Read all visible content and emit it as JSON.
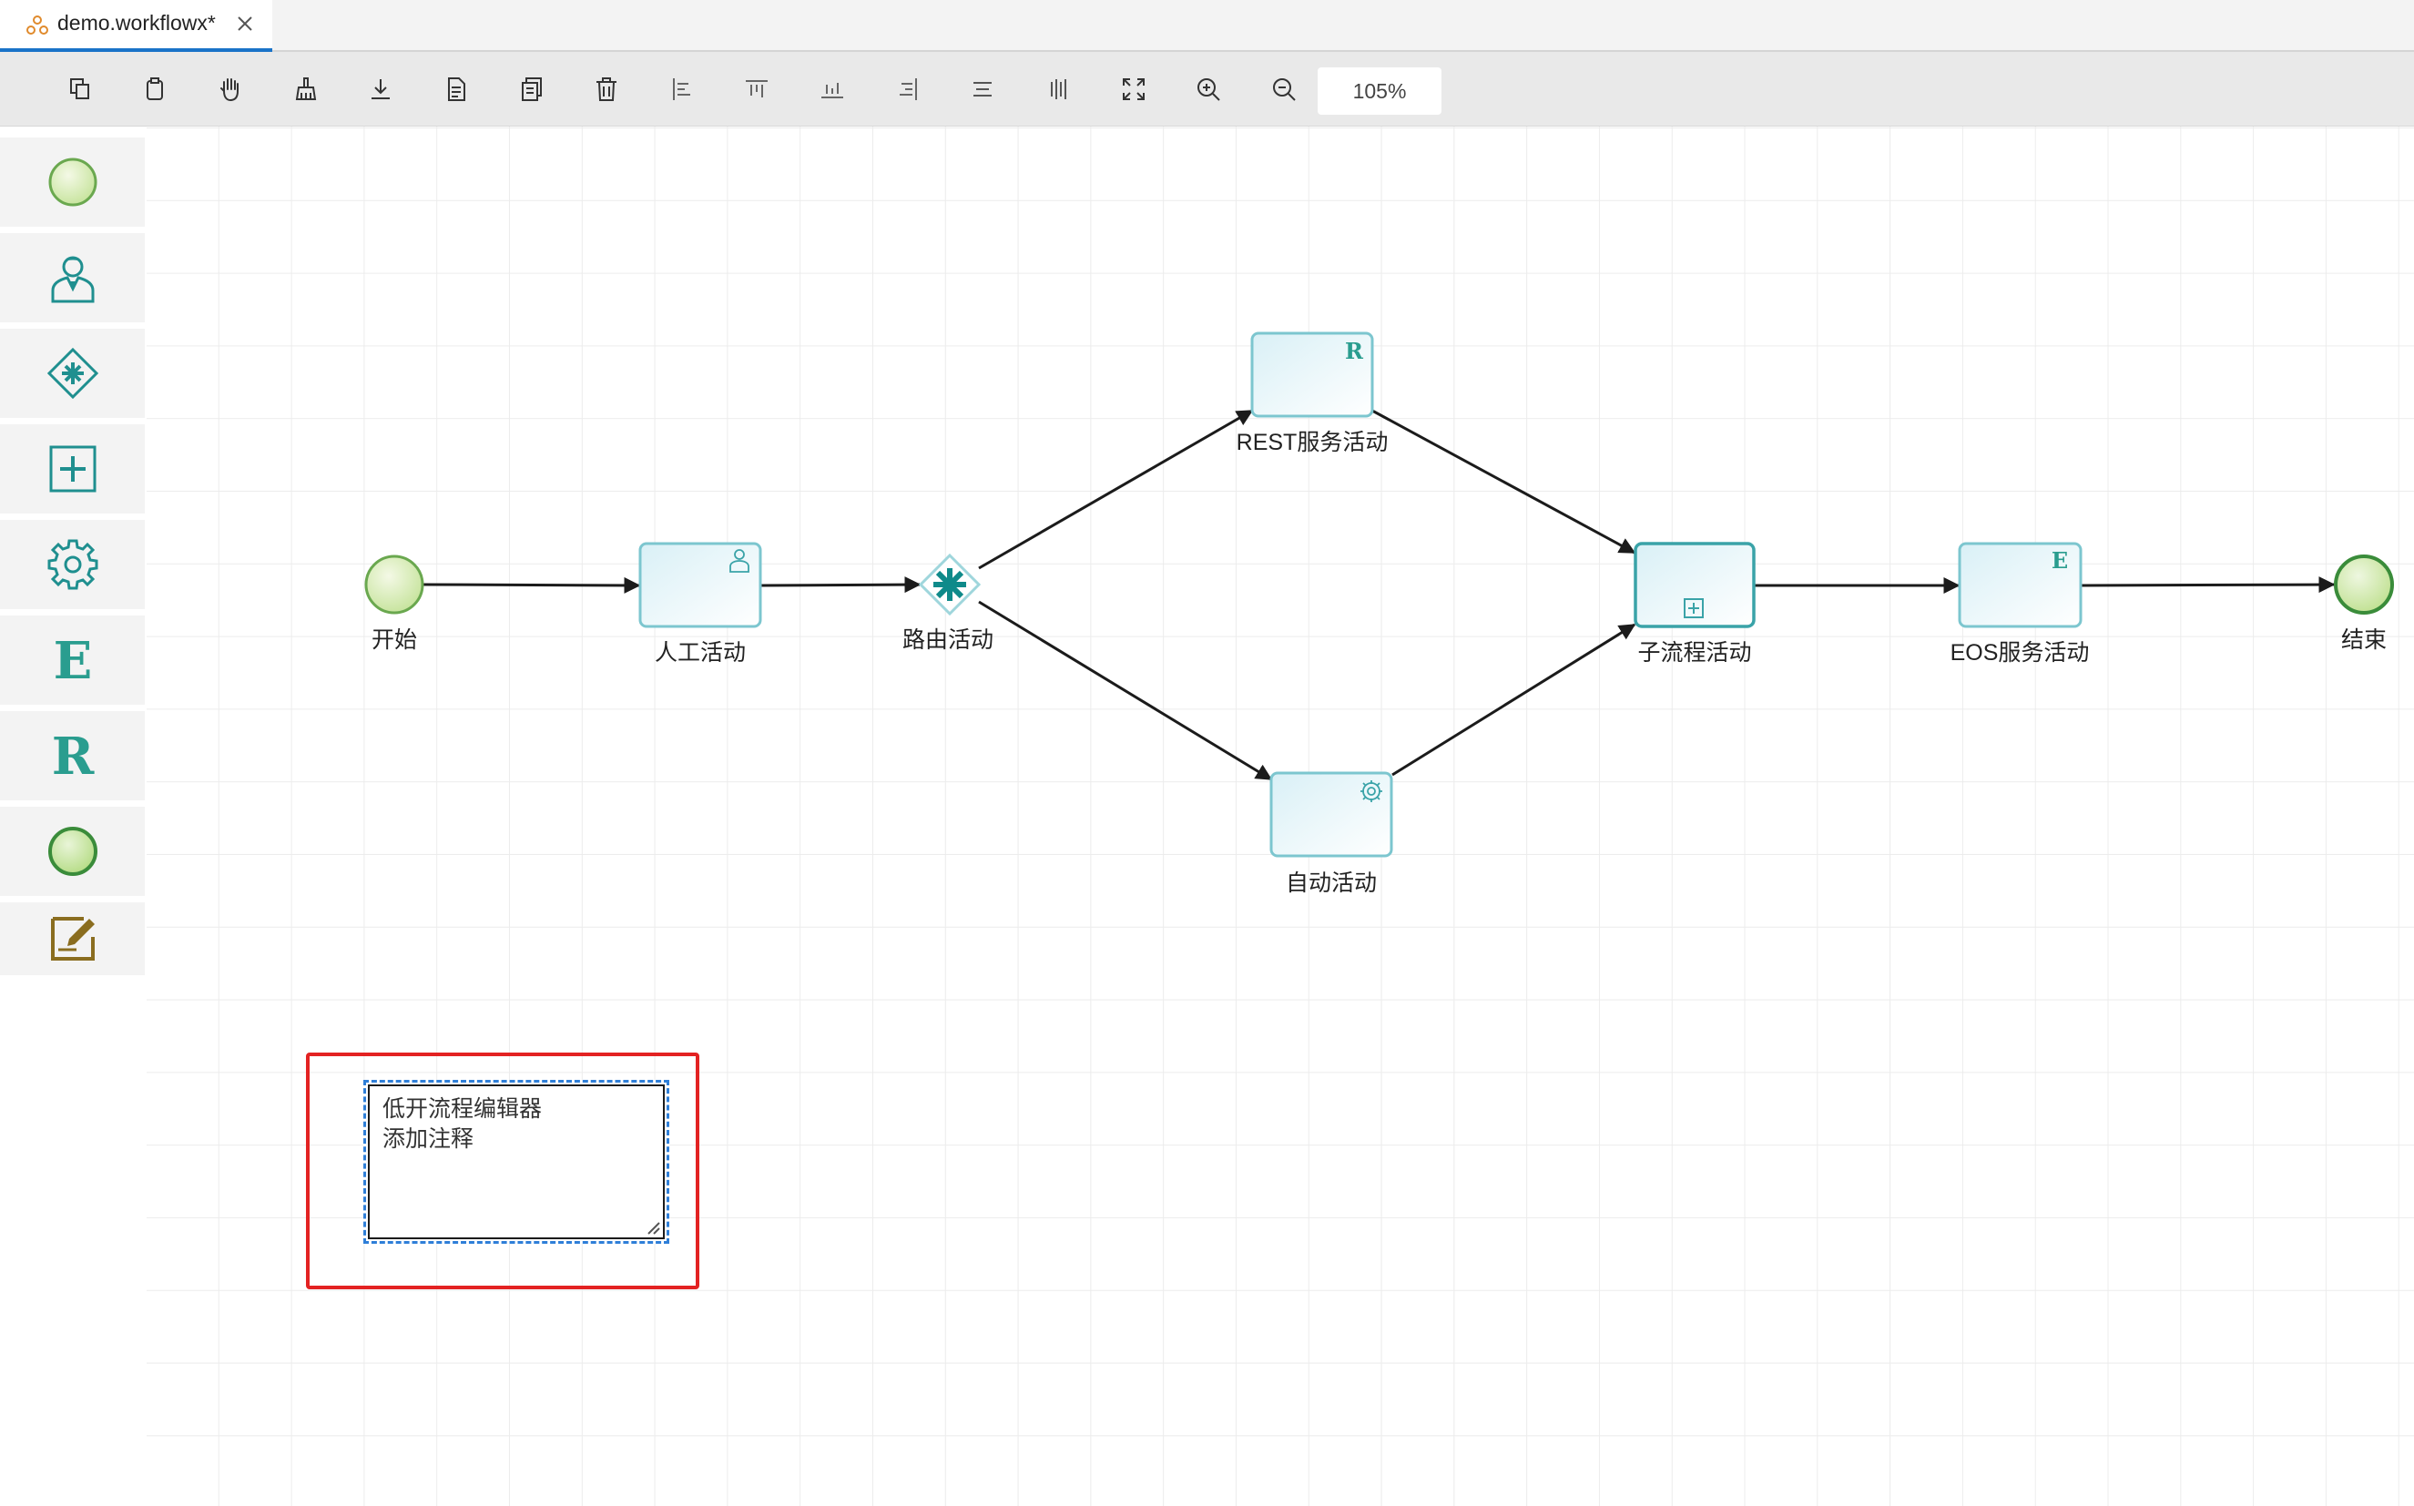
{
  "tab": {
    "title": "demo.workflowx*"
  },
  "toolbar": {
    "buttons": [
      "copy-icon",
      "paste-icon",
      "hand-icon",
      "broom-icon",
      "download-icon",
      "document-icon",
      "duplicate-icon",
      "trash-icon",
      "align-left-icon",
      "align-top-icon",
      "align-bottom-icon",
      "align-right-icon",
      "align-center-icon",
      "align-middle-icon",
      "fit-screen-icon",
      "zoom-in-icon",
      "zoom-out-icon"
    ],
    "zoom": "105%"
  },
  "palette": {
    "items": [
      "start-event-icon",
      "manual-activity-icon",
      "route-activity-icon",
      "subprocess-icon",
      "auto-activity-icon",
      "eos-service-icon",
      "rest-service-icon",
      "end-event-icon",
      "annotation-icon"
    ],
    "eos_glyph": "E",
    "rest_glyph": "R"
  },
  "nodes": {
    "start": "开始",
    "manual": "人工活动",
    "route": "路由活动",
    "rest": "REST服务活动",
    "auto": "自动活动",
    "subprocess": "子流程活动",
    "eos": "EOS服务活动",
    "end": "结束",
    "rest_glyph": "R",
    "eos_glyph": "E"
  },
  "annotation": {
    "line1": "低开流程编辑器",
    "line2": "添加注释"
  },
  "colors": {
    "accent": "#1a73c8",
    "teal": "#1f8f8f",
    "highlight": "#e32222",
    "selection": "#2f7fd8"
  }
}
